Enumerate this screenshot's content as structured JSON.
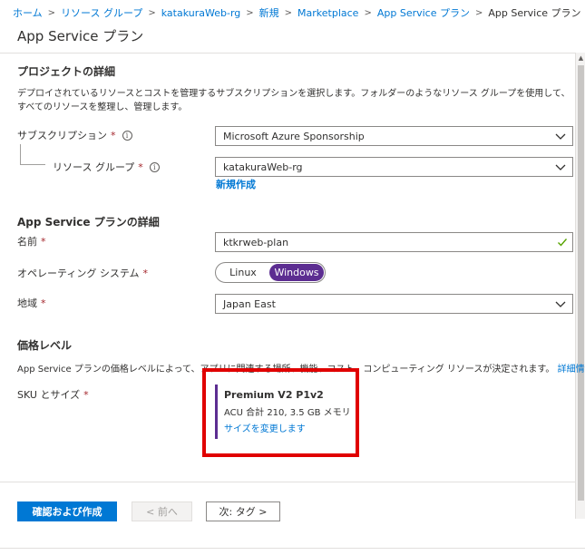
{
  "breadcrumb": {
    "items": [
      "ホーム",
      "リソース グループ",
      "katakuraWeb-rg",
      "新規",
      "Marketplace",
      "App Service プラン"
    ],
    "current": "App Service プラン",
    "separator": ">"
  },
  "page": {
    "title": "App Service プラン"
  },
  "project": {
    "heading": "プロジェクトの詳細",
    "description": "デプロイされているリソースとコストを管理するサブスクリプションを選択します。フォルダーのようなリソース グループを使用して、すべてのリソースを整理し、管理します。",
    "subscription": {
      "label": "サブスクリプション",
      "required": "*",
      "value": "Microsoft Azure Sponsorship"
    },
    "resource_group": {
      "label": "リソース グループ",
      "required": "*",
      "value": "katakuraWeb-rg",
      "create_new": "新規作成"
    }
  },
  "plan": {
    "heading": "App Service プランの詳細",
    "name": {
      "label": "名前",
      "required": "*",
      "value": "ktkrweb-plan",
      "valid": true
    },
    "os": {
      "label": "オペレーティング システム",
      "required": "*",
      "options": [
        "Linux",
        "Windows"
      ],
      "selected": "Windows"
    },
    "region": {
      "label": "地域",
      "required": "*",
      "value": "Japan East"
    }
  },
  "pricing": {
    "heading": "価格レベル",
    "description": "App Service プランの価格レベルによって、アプリに関連する場所、機能、コスト、コンピューティング リソースが決定されます。",
    "learn_more": "詳細情報",
    "sku": {
      "label": "SKU とサイズ",
      "required": "*",
      "name": "Premium V2 P1v2",
      "spec": "ACU 合計 210, 3.5 GB メモリ",
      "change": "サイズを変更します"
    }
  },
  "footer": {
    "review_create": "確認および作成",
    "previous": "< 前へ",
    "next": "次: タグ >"
  },
  "colors": {
    "accent": "#0078d4",
    "toggle_selected": "#5c2d91",
    "required": "#a4262c",
    "highlight": "#e00000",
    "valid_check": "#57a300"
  },
  "icons": [
    "info-icon",
    "chevron-down-icon",
    "checkmark-icon",
    "external-link-icon"
  ]
}
